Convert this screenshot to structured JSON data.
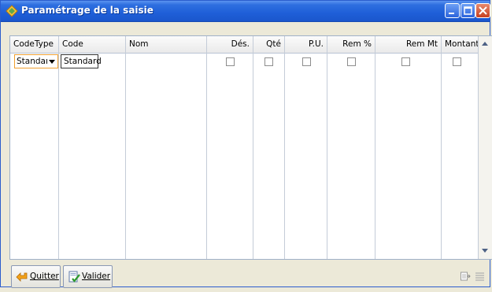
{
  "window": {
    "title": "Paramétrage de la saisie",
    "icon": "app-icon",
    "controls": [
      "minimize-icon",
      "maximize-icon",
      "close-icon"
    ]
  },
  "grid": {
    "columns": [
      {
        "label": "CodeType"
      },
      {
        "label": "Code"
      },
      {
        "label": "Nom"
      },
      {
        "label": "Dés."
      },
      {
        "label": "Qté"
      },
      {
        "label": "P.U."
      },
      {
        "label": "Rem %"
      },
      {
        "label": "Rem Mt"
      },
      {
        "label": "Montant"
      }
    ],
    "rows": [
      {
        "codetype": "Standaı",
        "code": "Standard",
        "nom": "",
        "des": false,
        "qte": false,
        "pu": false,
        "rem_pct": false,
        "rem_mt": false,
        "montant": false
      }
    ]
  },
  "buttons": {
    "quit_label": "Quitter",
    "validate_label": "Valider"
  },
  "colors": {
    "titlebar": "#1f5fd8",
    "grid_border": "#9fb1c9",
    "combo_focus": "#f0a030"
  }
}
